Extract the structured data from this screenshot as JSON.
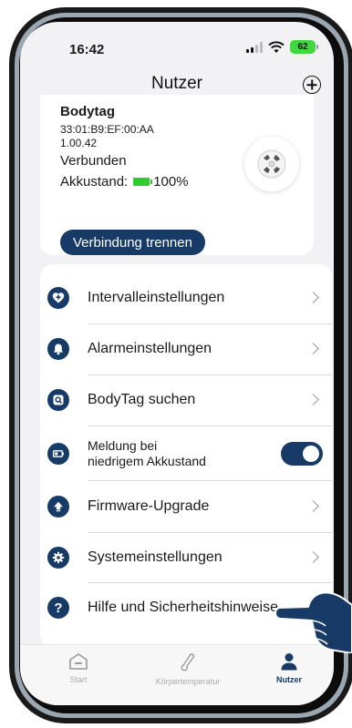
{
  "status_bar": {
    "time": "16:42",
    "battery": "62"
  },
  "header": {
    "title": "Nutzer",
    "add_icon": "plus-circle-icon"
  },
  "device": {
    "name": "Bodytag",
    "mac": "33:01:B9:EF:00:AA",
    "firmware": "1.00.42",
    "connection_status": "Verbunden",
    "battery_label": "Akkustand:",
    "battery_value": "100%",
    "disconnect_label": "Verbindung trennen"
  },
  "settings": {
    "items": [
      {
        "label": "Intervalleinstellungen",
        "icon": "heart-plus-icon"
      },
      {
        "label": "Alarmeinstellungen",
        "icon": "bell-icon"
      },
      {
        "label": "BodyTag suchen",
        "icon": "search-tag-icon"
      },
      {
        "label": "Meldung bei",
        "label2": "niedrigem Akkustand",
        "icon": "battery-icon",
        "toggle_on": true
      },
      {
        "label": "Firmware-Upgrade",
        "icon": "upload-icon"
      },
      {
        "label": "Systemeinstellungen",
        "icon": "gear-icon"
      },
      {
        "label": "Hilfe und Sicherheitshinweise",
        "icon": "help-icon"
      }
    ]
  },
  "tabs": [
    {
      "label": "Start",
      "icon": "home-icon"
    },
    {
      "label": "Körpertemperatur",
      "icon": "thermometer-icon"
    },
    {
      "label": "Nutzer",
      "icon": "user-icon",
      "active": true
    }
  ],
  "colors": {
    "primary": "#173a66",
    "battery_green": "#2ecc2e",
    "background": "#f2f2f4"
  }
}
